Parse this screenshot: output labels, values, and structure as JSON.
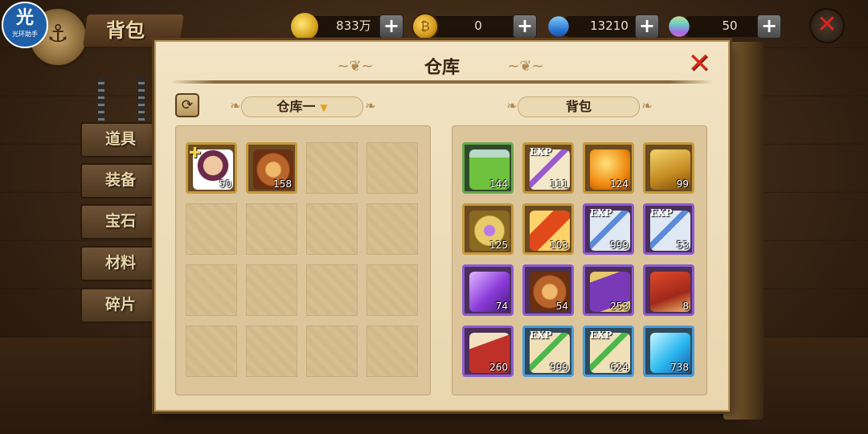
{
  "topbar": {
    "helper_logo_big": "光",
    "helper_logo_small": "光环助手",
    "bag_title": "背包",
    "resources": [
      {
        "icon": "gold-icon",
        "value": "833万"
      },
      {
        "icon": "coin-icon",
        "value": "0"
      },
      {
        "icon": "diamond-icon",
        "value": "13210"
      },
      {
        "icon": "gem-icon",
        "value": "50"
      }
    ],
    "plus_label": "+",
    "close_label": "✕"
  },
  "side_tabs": [
    "道具",
    "装备",
    "宝石",
    "材料",
    "碎片"
  ],
  "panel": {
    "title": "仓库",
    "close_label": "✕",
    "warehouse_label": "仓库一",
    "bag_label": "背包",
    "refresh_icon": "refresh-icon"
  },
  "warehouse_items": [
    {
      "name": "character-portrait",
      "qty": "50",
      "frame": "gold",
      "has_plus": true
    },
    {
      "name": "bronze-medallion",
      "qty": "158",
      "frame": "gold",
      "has_plus": false
    }
  ],
  "bag_items": [
    {
      "name": "green-potion",
      "qty": "144",
      "frame": "green",
      "exp": false
    },
    {
      "name": "exp-scroll-gold",
      "qty": "111",
      "frame": "gold",
      "exp": true
    },
    {
      "name": "orange-gem",
      "qty": "124",
      "frame": "gold",
      "exp": false
    },
    {
      "name": "gold-book",
      "qty": "99",
      "frame": "gold",
      "exp": false
    },
    {
      "name": "gold-amulet",
      "qty": "125",
      "frame": "gold",
      "exp": false
    },
    {
      "name": "orange-scroll",
      "qty": "103",
      "frame": "gold",
      "exp": false
    },
    {
      "name": "exp-scroll-purple",
      "qty": "999",
      "frame": "purple",
      "exp": true
    },
    {
      "name": "exp-scroll-purple",
      "qty": "53",
      "frame": "purple",
      "exp": true
    },
    {
      "name": "purple-crystal",
      "qty": "74",
      "frame": "purple",
      "exp": false
    },
    {
      "name": "bronze-medallion",
      "qty": "54",
      "frame": "purple",
      "exp": false
    },
    {
      "name": "purple-book",
      "qty": "253",
      "frame": "purple",
      "exp": false
    },
    {
      "name": "red-book",
      "qty": "8",
      "frame": "purple",
      "exp": false
    },
    {
      "name": "red-tome",
      "qty": "260",
      "frame": "purple",
      "exp": false
    },
    {
      "name": "exp-scroll-blue",
      "qty": "999",
      "frame": "blue",
      "exp": true
    },
    {
      "name": "exp-scroll-blue",
      "qty": "624",
      "frame": "blue",
      "exp": true
    },
    {
      "name": "blue-crystal",
      "qty": "738",
      "frame": "blue",
      "exp": false
    }
  ],
  "exp_label": "EXP",
  "colors": {
    "frame_gold": "#c49a3c",
    "frame_purple": "#8d5ad1",
    "frame_blue": "#4b9bd9",
    "frame_green": "#6aa84f",
    "close_red": "#d42a1c"
  }
}
